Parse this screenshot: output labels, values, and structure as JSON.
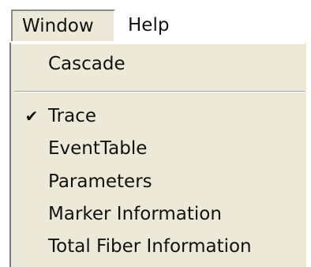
{
  "menubar": {
    "window_label": "Window",
    "help_label": "Help"
  },
  "window_menu": {
    "items": [
      {
        "label": "Cascade",
        "checked": false
      },
      {
        "label": "Trace",
        "checked": true,
        "check_glyph": "✔"
      },
      {
        "label": "EventTable",
        "checked": false
      },
      {
        "label": "Parameters",
        "checked": false
      },
      {
        "label": "Marker Information",
        "checked": false
      },
      {
        "label": "Total Fiber Information",
        "checked": false
      }
    ]
  }
}
